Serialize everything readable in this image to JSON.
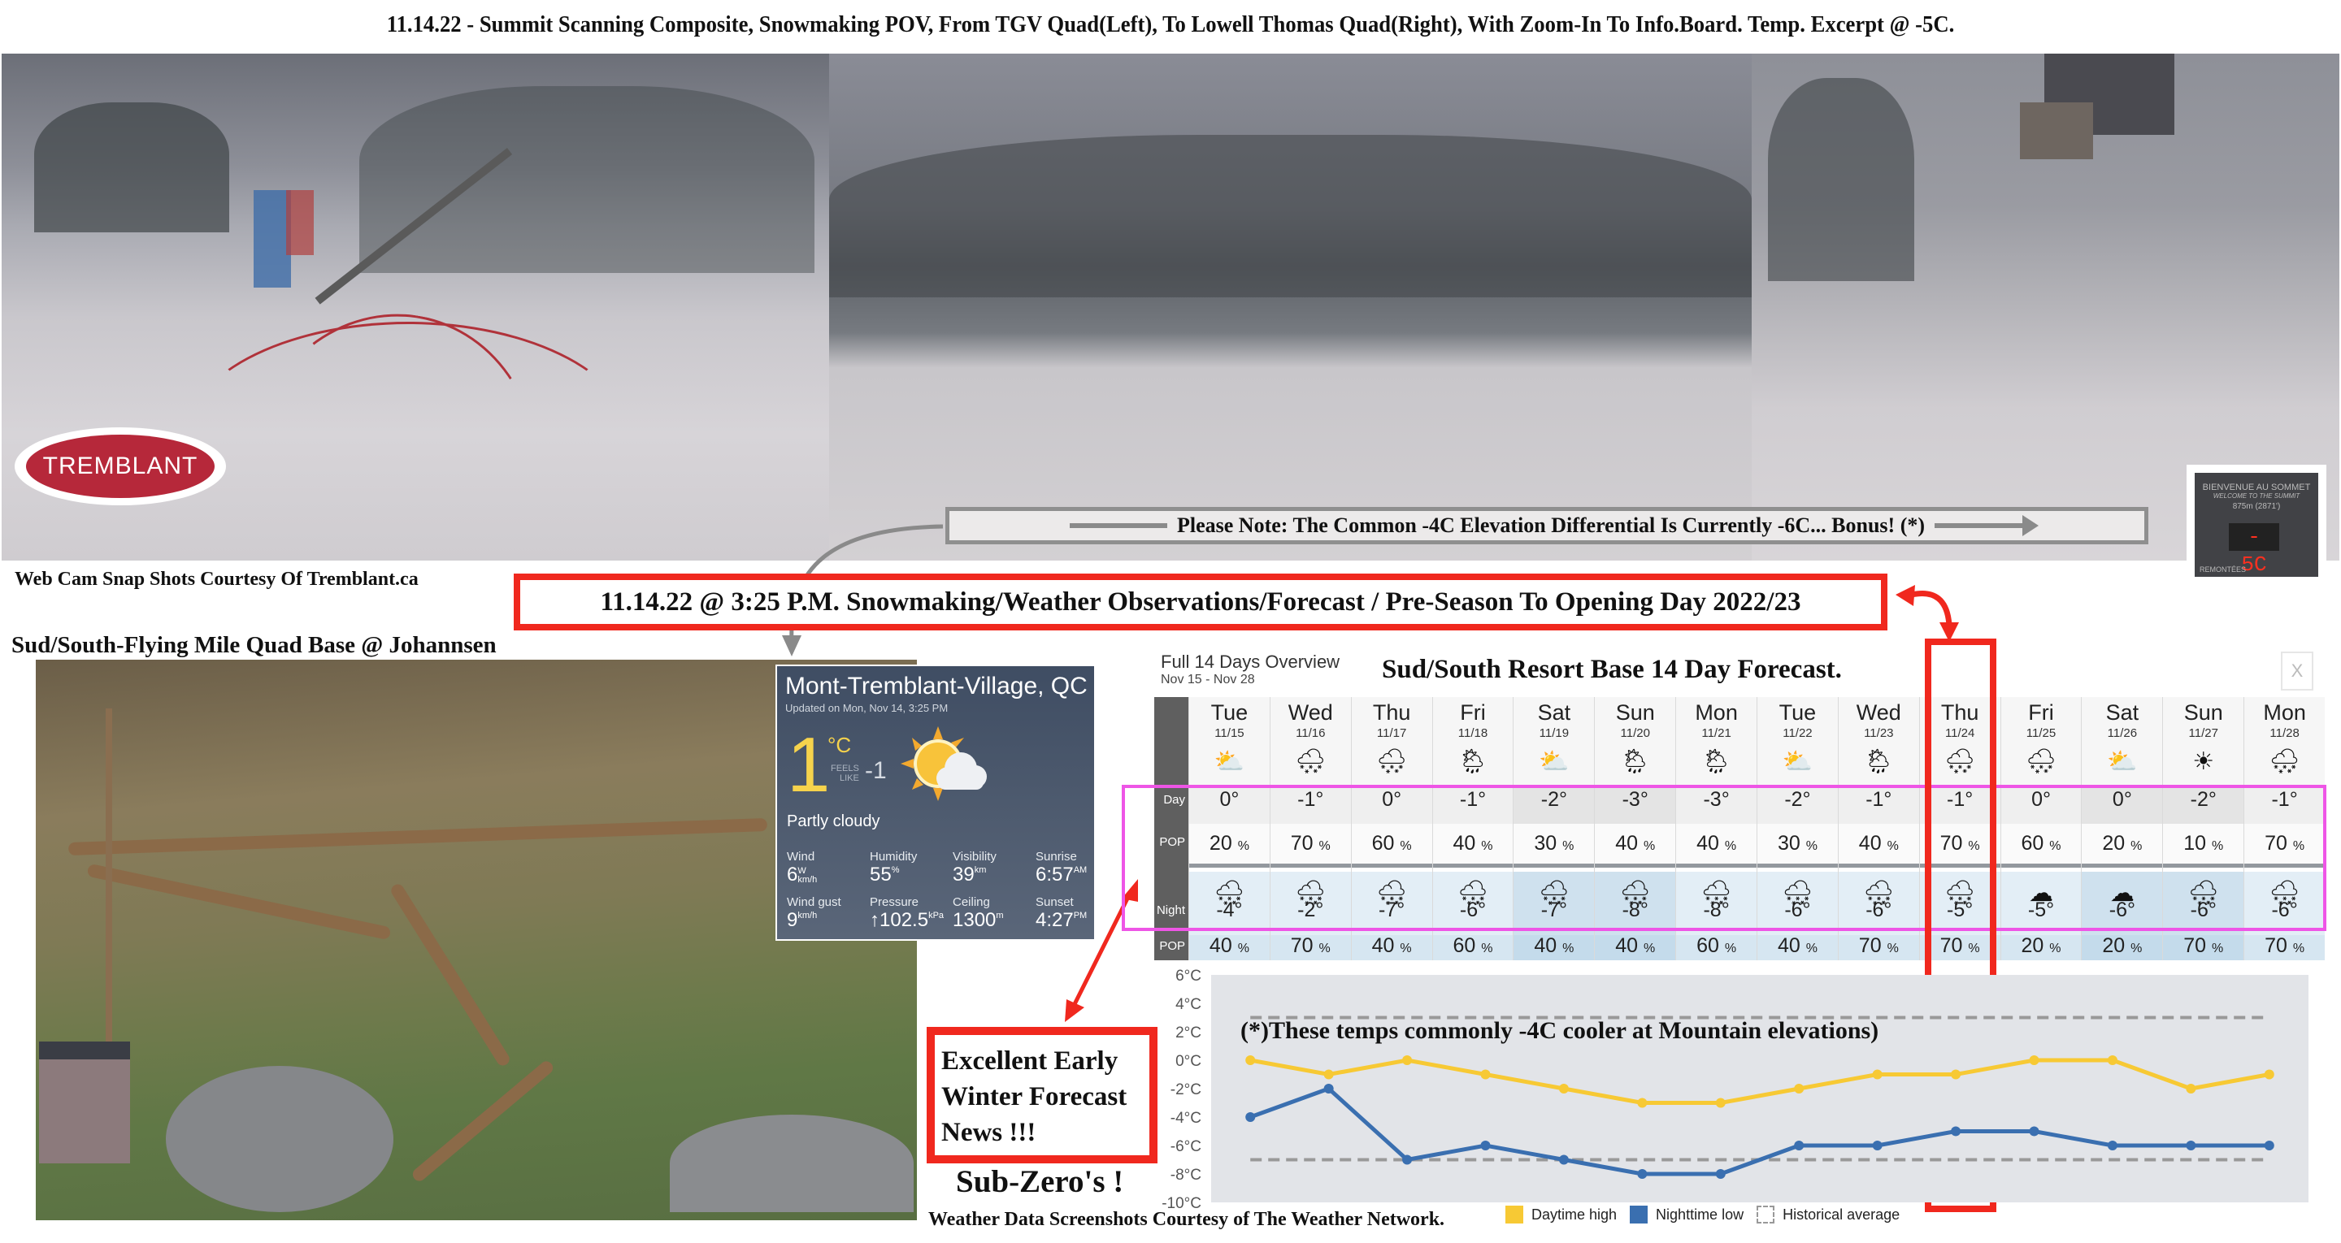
{
  "title": "11.14.22 - Summit Scanning Composite, Snowmaking POV, From TGV Quad(Left), To Lowell Thomas Quad(Right), With Zoom-In To Info.Board. Temp. Excerpt @ -5C.",
  "logo": {
    "text": "TREMBLANT"
  },
  "note": "Please Note: The Common -4C Elevation Differential Is Currently -6C... Bonus! (*)",
  "infoboard": {
    "line1": "BIENVENUE AU SOMMET",
    "line2": "WELCOME TO THE SUMMIT",
    "line3": "875m (2871')",
    "reading": "- 5C",
    "footer": "REMONTÉES"
  },
  "captions": {
    "webcam_credit": "Web Cam Snap Shots Courtesy Of Tremblant.ca",
    "base_cam": "Sud/South-Flying Mile Quad Base @ Johannsen",
    "headline": "11.14.22 @ 3:25 P.M. Snowmaking/Weather Observations/Forecast / Pre-Season To Opening Day 2022/23",
    "excellent": [
      "Excellent Early",
      "Winter Forecast",
      "News !!!"
    ],
    "subzero": "Sub-Zero's !",
    "weather_credit": "Weather Data Screenshots Courtesy of The Weather Network."
  },
  "current": {
    "location": "Mont-Tremblant-Village, QC",
    "updated": "Updated on Mon, Nov 14, 3:25 PM",
    "temp": "1",
    "unit": "°C",
    "feels_label_1": "FEELS",
    "feels_label_2": "LIKE",
    "feels": "-1",
    "condition": "Partly cloudy",
    "icon": "partly-cloudy-icon",
    "stats": [
      {
        "label": "Wind",
        "value": "6",
        "unit": "km/h",
        "extra": "W"
      },
      {
        "label": "Humidity",
        "value": "55",
        "unit": "%"
      },
      {
        "label": "Visibility",
        "value": "39",
        "unit": "km"
      },
      {
        "label": "Sunrise",
        "value": "6:57",
        "unit": "AM"
      },
      {
        "label": "Wind gust",
        "value": "9",
        "unit": "km/h"
      },
      {
        "label": "Pressure",
        "value": "↑102.5",
        "unit": "kPa"
      },
      {
        "label": "Ceiling",
        "value": "1300",
        "unit": "m"
      },
      {
        "label": "Sunset",
        "value": "4:27",
        "unit": "PM"
      }
    ]
  },
  "forecast": {
    "overview_label": "Full 14 Days Overview",
    "range": "Nov 15 - Nov 28",
    "title": "Sud/South Resort Base 14  Day Forecast.",
    "close_label": "X",
    "row_labels": {
      "day": "Day",
      "pop": "POP",
      "night": "Night",
      "npop": "POP"
    },
    "highlighted_day": "Thu 11/24",
    "days": [
      {
        "dow": "Tue",
        "date": "11/15",
        "day_icon": "sun-cloud",
        "day": "0°",
        "day_pop": "20",
        "night_icon": "snow-cloud",
        "night": "-4°",
        "night_pop": "40",
        "shade": false
      },
      {
        "dow": "Wed",
        "date": "11/16",
        "day_icon": "snow-cloud",
        "day": "-1°",
        "day_pop": "70",
        "night_icon": "snow-cloud",
        "night": "-2°",
        "night_pop": "70",
        "shade": false
      },
      {
        "dow": "Thu",
        "date": "11/17",
        "day_icon": "snow-cloud",
        "day": "0°",
        "day_pop": "60",
        "night_icon": "moon-snow",
        "night": "-7°",
        "night_pop": "40",
        "shade": false
      },
      {
        "dow": "Fri",
        "date": "11/18",
        "day_icon": "sun-snow",
        "day": "-1°",
        "day_pop": "40",
        "night_icon": "moon-snow",
        "night": "-6°",
        "night_pop": "60",
        "shade": false
      },
      {
        "dow": "Sat",
        "date": "11/19",
        "day_icon": "sun-cloud",
        "day": "-2°",
        "day_pop": "30",
        "night_icon": "moon-snow",
        "night": "-7°",
        "night_pop": "40",
        "shade": true
      },
      {
        "dow": "Sun",
        "date": "11/20",
        "day_icon": "sun-snow",
        "day": "-3°",
        "day_pop": "40",
        "night_icon": "moon-snow",
        "night": "-8°",
        "night_pop": "40",
        "shade": true
      },
      {
        "dow": "Mon",
        "date": "11/21",
        "day_icon": "sun-snow",
        "day": "-3°",
        "day_pop": "40",
        "night_icon": "snow-cloud",
        "night": "-8°",
        "night_pop": "60",
        "shade": false
      },
      {
        "dow": "Tue",
        "date": "11/22",
        "day_icon": "sun-cloud",
        "day": "-2°",
        "day_pop": "30",
        "night_icon": "moon-snow",
        "night": "-6°",
        "night_pop": "40",
        "shade": false
      },
      {
        "dow": "Wed",
        "date": "11/23",
        "day_icon": "sun-snow",
        "day": "-1°",
        "day_pop": "40",
        "night_icon": "snow-cloud",
        "night": "-6°",
        "night_pop": "70",
        "shade": false
      },
      {
        "dow": "Thu",
        "date": "11/24",
        "day_icon": "snow-cloud",
        "day": "-1°",
        "day_pop": "70",
        "night_icon": "snow-cloud",
        "night": "-5°",
        "night_pop": "70",
        "shade": false
      },
      {
        "dow": "Fri",
        "date": "11/25",
        "day_icon": "snow-cloud",
        "day": "0°",
        "day_pop": "60",
        "night_icon": "moon-cloud",
        "night": "-5°",
        "night_pop": "20",
        "shade": false
      },
      {
        "dow": "Sat",
        "date": "11/26",
        "day_icon": "sun-cloud",
        "day": "0°",
        "day_pop": "20",
        "night_icon": "moon-cloud",
        "night": "-6°",
        "night_pop": "20",
        "shade": true
      },
      {
        "dow": "Sun",
        "date": "11/27",
        "day_icon": "sun",
        "day": "-2°",
        "day_pop": "10",
        "night_icon": "snow-cloud",
        "night": "-6°",
        "night_pop": "70",
        "shade": true
      },
      {
        "dow": "Mon",
        "date": "11/28",
        "day_icon": "snow-cloud",
        "day": "-1°",
        "day_pop": "70",
        "night_icon": "snow-cloud",
        "night": "-6°",
        "night_pop": "70",
        "shade": false
      }
    ]
  },
  "chart_data": {
    "type": "line",
    "title": "",
    "annotation": "(*)These temps commonly -4C cooler at Mountain elevations)",
    "x": [
      "11/15",
      "11/16",
      "11/17",
      "11/18",
      "11/19",
      "11/20",
      "11/21",
      "11/22",
      "11/23",
      "11/24",
      "11/25",
      "11/26",
      "11/27",
      "11/28"
    ],
    "ylim": [
      -10,
      6
    ],
    "yticks": [
      6,
      4,
      2,
      0,
      -2,
      -4,
      -6,
      -8,
      -10
    ],
    "ytick_labels": [
      "6°C",
      "4°C",
      "2°C",
      "0°C",
      "-2°C",
      "-4°C",
      "-6°C",
      "-8°C",
      "-10°C"
    ],
    "series": [
      {
        "name": "Daytime high",
        "color": "#f7c934",
        "values": [
          0,
          -1,
          0,
          -1,
          -2,
          -3,
          -3,
          -2,
          -1,
          -1,
          0,
          0,
          -2,
          -1
        ]
      },
      {
        "name": "Nighttime low",
        "color": "#3a6fb0",
        "values": [
          -4,
          -2,
          -7,
          -6,
          -7,
          -8,
          -8,
          -6,
          -6,
          -5,
          -5,
          -6,
          -6,
          -6
        ]
      }
    ],
    "historical_average": {
      "name": "Historical average",
      "high": 3,
      "low": -7
    },
    "legend": "bottom",
    "grid": false
  }
}
